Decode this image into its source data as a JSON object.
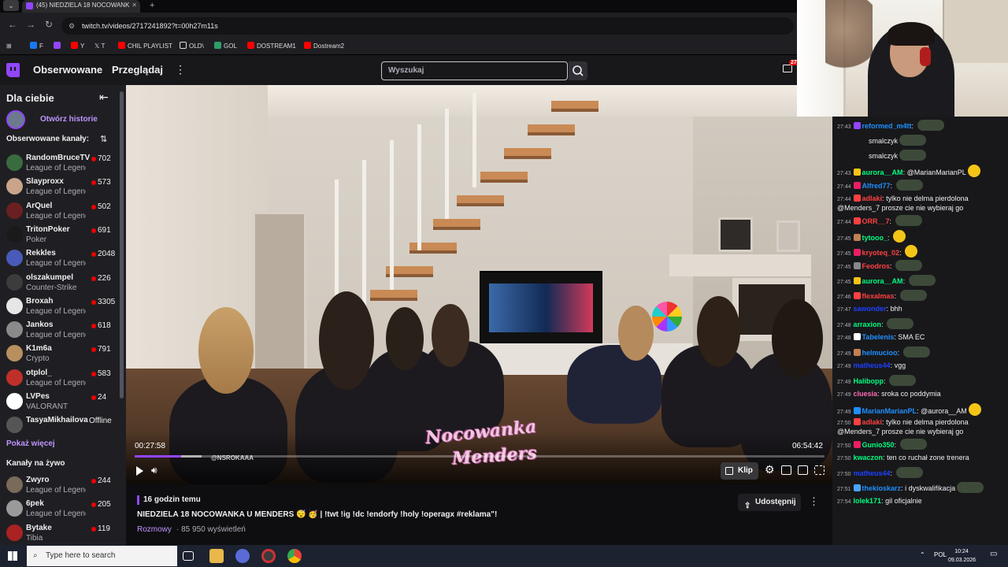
{
  "browser": {
    "tab_title": "(45) NIEDZIELA 18 NOCOWANK",
    "url": "twitch.tv/videos/2717241892?t=00h27m11s",
    "bookmarks": [
      {
        "label": "F",
        "color": "#1877f2"
      },
      {
        "label": "",
        "color": "#9146ff"
      },
      {
        "label": "Y",
        "color": "#ff0000"
      },
      {
        "label": "T",
        "color": "#cccccc"
      },
      {
        "label": "CHIL PLAYLIST",
        "color": "#ff0000"
      },
      {
        "label": "OLD\\",
        "color": "#e0b54a"
      },
      {
        "label": "GOL",
        "color": "#2f9e6a"
      },
      {
        "label": "DOSTREAM1",
        "color": "#ff0000"
      },
      {
        "label": "Dostream2",
        "color": "#ff0000"
      }
    ]
  },
  "twitch_nav": {
    "following": "Obserwowane",
    "browse": "Przeglądaj",
    "search_placeholder": "Wyszukaj",
    "notif_count": "27"
  },
  "sidebar": {
    "title": "Dla ciebie",
    "story_label": "Otwórz historie",
    "followed_header": "Obserwowane kanały:",
    "followed": [
      {
        "name": "RandomBruceTV",
        "game": "League of Legends",
        "viewers": "702",
        "avatar": "#3a6b3f"
      },
      {
        "name": "Slayproxx",
        "game": "League of Legends",
        "viewers": "573",
        "avatar": "#c9a48a"
      },
      {
        "name": "ArQuel",
        "game": "League of Legends",
        "viewers": "502",
        "avatar": "#6a2020"
      },
      {
        "name": "TritonPoker",
        "game": "Poker",
        "viewers": "691",
        "avatar": "#1a1a1a"
      },
      {
        "name": "Rekkles",
        "game": "League of Legends",
        "viewers": "2048",
        "avatar": "#4a5ab8"
      },
      {
        "name": "olszakumpel",
        "game": "Counter-Strike",
        "viewers": "226",
        "avatar": "#3c3c3c"
      },
      {
        "name": "Broxah",
        "game": "League of Legends",
        "viewers": "3305",
        "avatar": "#e6e6e6"
      },
      {
        "name": "Jankos",
        "game": "League of Legends",
        "viewers": "618",
        "avatar": "#8a8a8a"
      },
      {
        "name": "K1m6a",
        "game": "Crypto",
        "viewers": "791",
        "avatar": "#b89060"
      },
      {
        "name": "otplol_",
        "game": "League of Legends",
        "viewers": "583",
        "avatar": "#c0302a"
      },
      {
        "name": "LVPes",
        "game": "VALORANT",
        "viewers": "24",
        "avatar": "#ffffff"
      },
      {
        "name": "TasyaMikhailova",
        "game": "",
        "viewers": "",
        "offline": "Offline",
        "avatar": "#555"
      }
    ],
    "show_more": "Pokaż więcej",
    "live_header": "Kanały na żywo",
    "live": [
      {
        "name": "Zwyro",
        "game": "League of Legends",
        "viewers": "244",
        "avatar": "#7a6a5a"
      },
      {
        "name": "6pek",
        "game": "League of Legends",
        "viewers": "205",
        "avatar": "#9a9a9a"
      },
      {
        "name": "Bytake",
        "game": "Tibia",
        "viewers": "119",
        "avatar": "#aa2222"
      }
    ]
  },
  "player": {
    "current_time": "00:27:58",
    "total_time": "06:54:42",
    "progress": 0.0674,
    "watermark_line1": "Nocowanka",
    "watermark_line2": "Menders",
    "watermark_handle": "@NSROKAAA",
    "clip_label": "Klip"
  },
  "video_info": {
    "ago": "16 godzin temu",
    "title": "NIEDZIELA 18 NOCOWANKA U MENDERS 😴 🥳 | !twt !ig !dc !endorfy !holy !operagx #reklama\"!",
    "category": "Rozmowy",
    "views": "· 85 950 wyświetleń",
    "share_label": "Udostępnij"
  },
  "chat": {
    "messages": [
      {
        "ts": "27:43",
        "user": "reformed_m4tt",
        "color": "#1e90ff",
        "text": "",
        "emote": "g",
        "badge": "#9146ff"
      },
      {
        "ts": "",
        "user": "",
        "color": "#fff",
        "text": "smalczyk",
        "emote": "g",
        "badge": ""
      },
      {
        "ts": "",
        "user": "",
        "color": "#fff",
        "text": "smalczyk",
        "emote": "g",
        "badge": ""
      },
      {
        "ts": "27:43",
        "user": "aurora__AM",
        "color": "#00ff7f",
        "text": "@MarianMarianPL",
        "emote": "y",
        "badge": "#f5c516"
      },
      {
        "ts": "27:44",
        "user": "Alfred77",
        "color": "#1e90ff",
        "text": "",
        "emote": "g",
        "badge": "#e91e63"
      },
      {
        "ts": "27:44",
        "user": "adlaki",
        "color": "#ff4040",
        "text": "tylko nie delma pierdolona @Menders_7 prosze cie nie wybieraj go",
        "emote": "",
        "badge": "#ff4040"
      },
      {
        "ts": "27:44",
        "user": "ORR__7",
        "color": "#ff4040",
        "text": "",
        "emote": "g",
        "badge": "#ff4040"
      },
      {
        "ts": "27:45",
        "user": "tytooo_",
        "color": "#00ff7f",
        "text": "",
        "emote": "y",
        "badge": "#c08050"
      },
      {
        "ts": "27:45",
        "user": "kryoteq_02",
        "color": "#ff4040",
        "text": "",
        "emote": "y",
        "badge": "#e91e63"
      },
      {
        "ts": "27:45",
        "user": "Feodros",
        "color": "#ff4040",
        "text": "",
        "emote": "g",
        "badge": "#888"
      },
      {
        "ts": "27:45",
        "user": "aurora__AM",
        "color": "#00ff7f",
        "text": "",
        "emote": "g",
        "badge": "#f5c516"
      },
      {
        "ts": "27:46",
        "user": "flexalmas",
        "color": "#ff4040",
        "text": "",
        "emote": "g",
        "badge": "#ff4040"
      },
      {
        "ts": "27:47",
        "user": "sawonder",
        "color": "#1e40ff",
        "text": "bhh",
        "emote": "",
        "badge": ""
      },
      {
        "ts": "27:48",
        "user": "arraxion",
        "color": "#00ff7f",
        "text": "",
        "emote": "g",
        "badge": ""
      },
      {
        "ts": "27:48",
        "user": "Tabelenis",
        "color": "#1e90ff",
        "text": "SMA     EC",
        "emote": "",
        "badge": "#fff"
      },
      {
        "ts": "27:49",
        "user": "helmucioo",
        "color": "#1e90ff",
        "text": "",
        "emote": "g",
        "badge": "#c08050"
      },
      {
        "ts": "27:49",
        "user": "matheus44",
        "color": "#1e40ff",
        "text": "vgg",
        "emote": "",
        "badge": ""
      },
      {
        "ts": "27:49",
        "user": "Halibopp",
        "color": "#00ff7f",
        "text": "",
        "emote": "g",
        "badge": ""
      },
      {
        "ts": "27:49",
        "user": "cluesia",
        "color": "#ff69b4",
        "text": "sroka co poddymia",
        "emote": "",
        "badge": ""
      },
      {
        "ts": "27:49",
        "user": "MarianMarianPL",
        "color": "#1e90ff",
        "text": "@aurora__AM",
        "emote": "y",
        "badge": "#1e90ff"
      },
      {
        "ts": "27:50",
        "user": "adlaki",
        "color": "#ff4040",
        "text": "tylko nie delma pierdolona @Menders_7 prosze cie nie wybieraj go",
        "emote": "",
        "badge": "#ff4040"
      },
      {
        "ts": "27:50",
        "user": "Gunio350",
        "color": "#00ff7f",
        "text": "",
        "emote": "g",
        "badge": "#e91e63"
      },
      {
        "ts": "27:50",
        "user": "kwaczon",
        "color": "#00ff7f",
        "text": "ten co ruchał zone trenera",
        "emote": "",
        "badge": ""
      },
      {
        "ts": "27:50",
        "user": "matheus44",
        "color": "#1e40ff",
        "text": "",
        "emote": "g",
        "badge": ""
      },
      {
        "ts": "27:51",
        "user": "thekioskarz",
        "color": "#1e90ff",
        "text": "i dyskwalifikacja",
        "emote": "g",
        "badge": "#4aa3ff"
      },
      {
        "ts": "27:54",
        "user": "lolek171",
        "color": "#00ff7f",
        "text": "gil oficjalnie",
        "emote": "",
        "badge": ""
      }
    ]
  },
  "taskbar": {
    "search_placeholder": "Type here to search",
    "lang": "POL",
    "time": "10:24",
    "date": "09.03.2026"
  }
}
